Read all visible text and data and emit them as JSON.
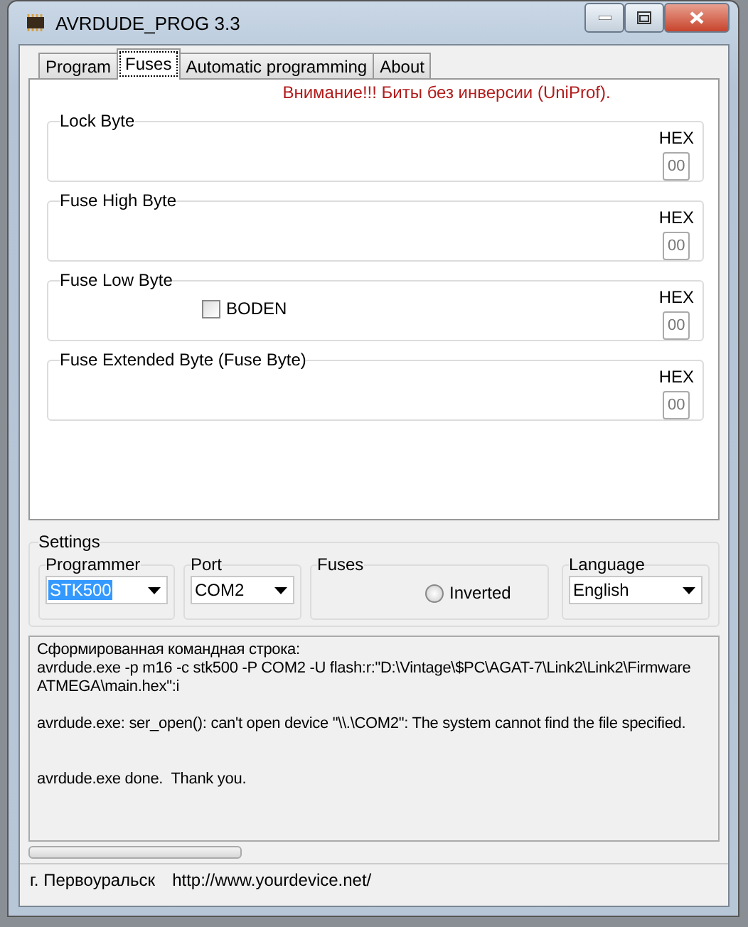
{
  "window": {
    "title": "AVRDUDE_PROG 3.3"
  },
  "tabs": [
    {
      "label": "Program",
      "selected": false
    },
    {
      "label": "Fuses",
      "selected": true
    },
    {
      "label": "Automatic programming",
      "selected": false
    },
    {
      "label": "About",
      "selected": false
    }
  ],
  "warning": "Внимание!!! Биты без инверсии (UniProf).",
  "fuse_groups": [
    {
      "title": "Lock Byte",
      "hex_label": "HEX",
      "hex_value": "00"
    },
    {
      "title": "Fuse High Byte",
      "hex_label": "HEX",
      "hex_value": "00"
    },
    {
      "title": "Fuse Low Byte",
      "hex_label": "HEX",
      "hex_value": "00",
      "checkboxes": [
        {
          "label": "BODEN",
          "checked": false
        }
      ]
    },
    {
      "title": "Fuse Extended Byte (Fuse Byte)",
      "hex_label": "HEX",
      "hex_value": "00"
    }
  ],
  "settings": {
    "title": "Settings",
    "programmer": {
      "label": "Programmer",
      "value": "STK500"
    },
    "port": {
      "label": "Port",
      "value": "COM2"
    },
    "fuses": {
      "label": "Fuses",
      "option": "Inverted",
      "selected": false
    },
    "language": {
      "label": "Language",
      "value": "English"
    }
  },
  "log": [
    {
      "kind": "block",
      "lines": [
        "Сформированная командная строка:",
        "avrdude.exe -p m16 -c stk500 -P COM2 -U flash:r:\"D:\\Vintage\\$PC\\AGAT-7\\Link2\\Link2\\Firmware",
        "ATMEGA\\main.hex\":i"
      ]
    },
    {
      "kind": "block",
      "lines": [
        "avrdude.exe: ser_open(): can't open device \"\\\\.\\COM2\": The system cannot find the file specified."
      ]
    },
    {
      "kind": "final",
      "lines": [
        "avrdude.exe done.  Thank you."
      ]
    }
  ],
  "status_bar": {
    "city": "г. Первоуральск",
    "url": "http://www.yourdevice.net/"
  }
}
